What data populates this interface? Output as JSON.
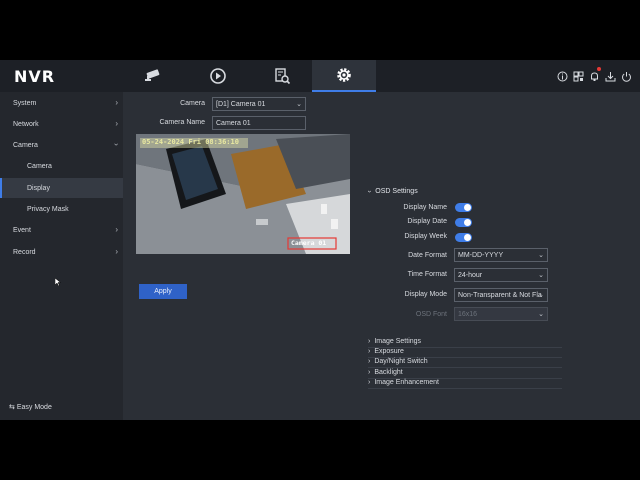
{
  "app": {
    "logo": "NVR"
  },
  "nav": [
    {
      "name": "live-view",
      "active": false
    },
    {
      "name": "playback",
      "active": false
    },
    {
      "name": "search",
      "active": false
    },
    {
      "name": "settings",
      "active": true
    }
  ],
  "sidebar": {
    "system": "System",
    "network": "Network",
    "camera": "Camera",
    "camera_sub": "Camera",
    "display": "Display",
    "privacy_mask": "Privacy Mask",
    "event": "Event",
    "record": "Record",
    "easy_mode": "Easy Mode"
  },
  "form": {
    "camera_label": "Camera",
    "camera_value": "[D1] Camera 01",
    "camera_name_label": "Camera Name",
    "camera_name_value": "Camera 01",
    "apply": "Apply"
  },
  "video": {
    "osd_date": "05-24-2024 Fri 08:36:10",
    "osd_name": "Camera 01"
  },
  "osd": {
    "heading": "OSD Settings",
    "display_name_label": "Display Name",
    "display_date_label": "Display Date",
    "display_week_label": "Display Week",
    "display_name_on": true,
    "display_date_on": true,
    "display_week_on": true,
    "date_format_label": "Date Format",
    "date_format_value": "MM-DD-YYYY",
    "time_format_label": "Time Format",
    "time_format_value": "24-hour",
    "display_mode_label": "Display Mode",
    "display_mode_value": "Non-Transparent & Not Fla",
    "osd_font_label": "OSD Font",
    "osd_font_value": "16x16"
  },
  "sections": {
    "image_settings": "Image Settings",
    "exposure": "Exposure",
    "day_night": "Day/Night Switch",
    "backlight": "Backlight",
    "image_enhancement": "Image Enhancement"
  },
  "colors": {
    "accent": "#3f7de8",
    "background": "#2b2f36",
    "sidebar": "#24272d",
    "topbar": "#1d2026"
  }
}
